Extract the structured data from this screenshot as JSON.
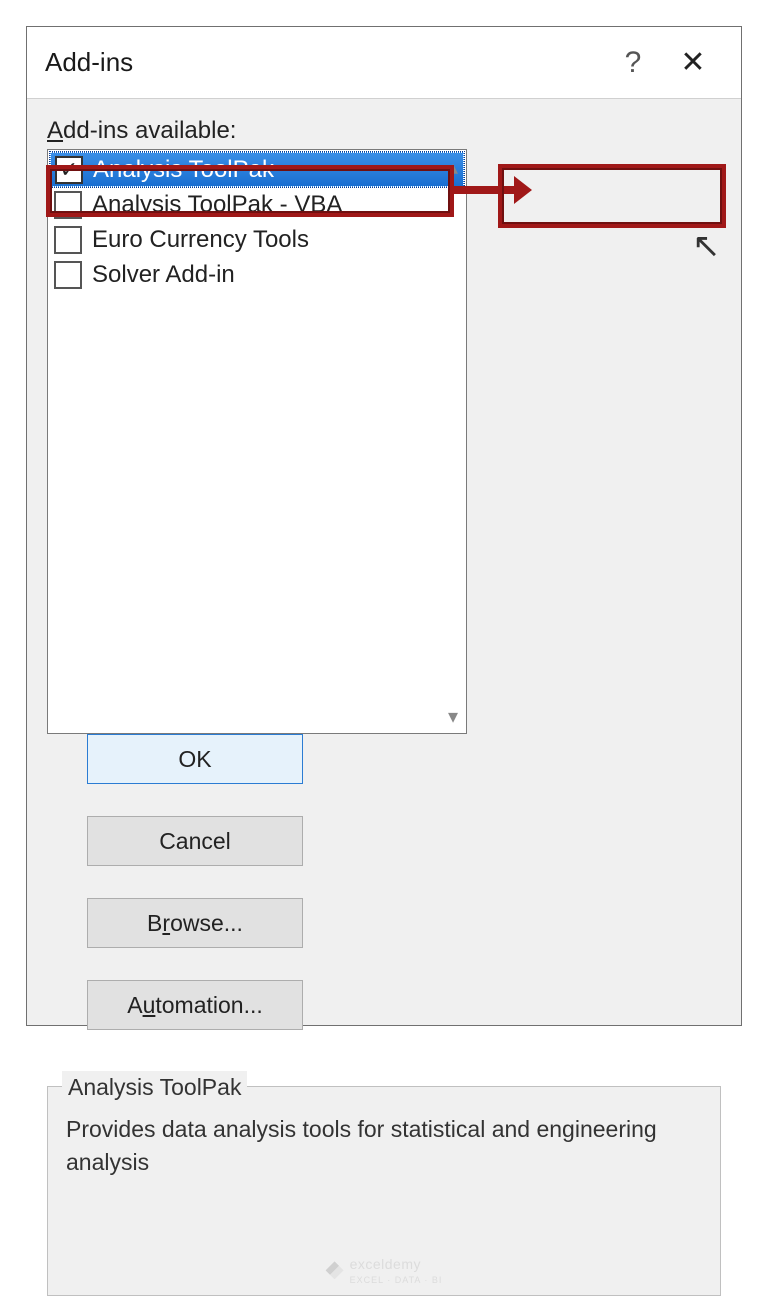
{
  "dialog": {
    "title": "Add-ins",
    "help_symbol": "?",
    "close_symbol": "✕"
  },
  "label_available": "dd-ins available:",
  "label_available_ul": "A",
  "addins": [
    {
      "label": "Analysis ToolPak",
      "checked": true,
      "selected": true
    },
    {
      "label": "Analysis ToolPak - VBA",
      "checked": false,
      "selected": false
    },
    {
      "label": "Euro Currency Tools",
      "checked": false,
      "selected": false
    },
    {
      "label": "Solver Add-in",
      "checked": false,
      "selected": false
    }
  ],
  "buttons": {
    "ok": "OK",
    "cancel": "Cancel",
    "browse_pre": "B",
    "browse_ul": "r",
    "browse_post": "owse...",
    "automation_pre": "A",
    "automation_ul": "u",
    "automation_post": "tomation..."
  },
  "description": {
    "legend": "Analysis ToolPak",
    "text": "Provides data analysis tools for statistical and engineering analysis"
  },
  "watermark": {
    "brand": "exceldemy",
    "tagline": "EXCEL · DATA · BI"
  }
}
